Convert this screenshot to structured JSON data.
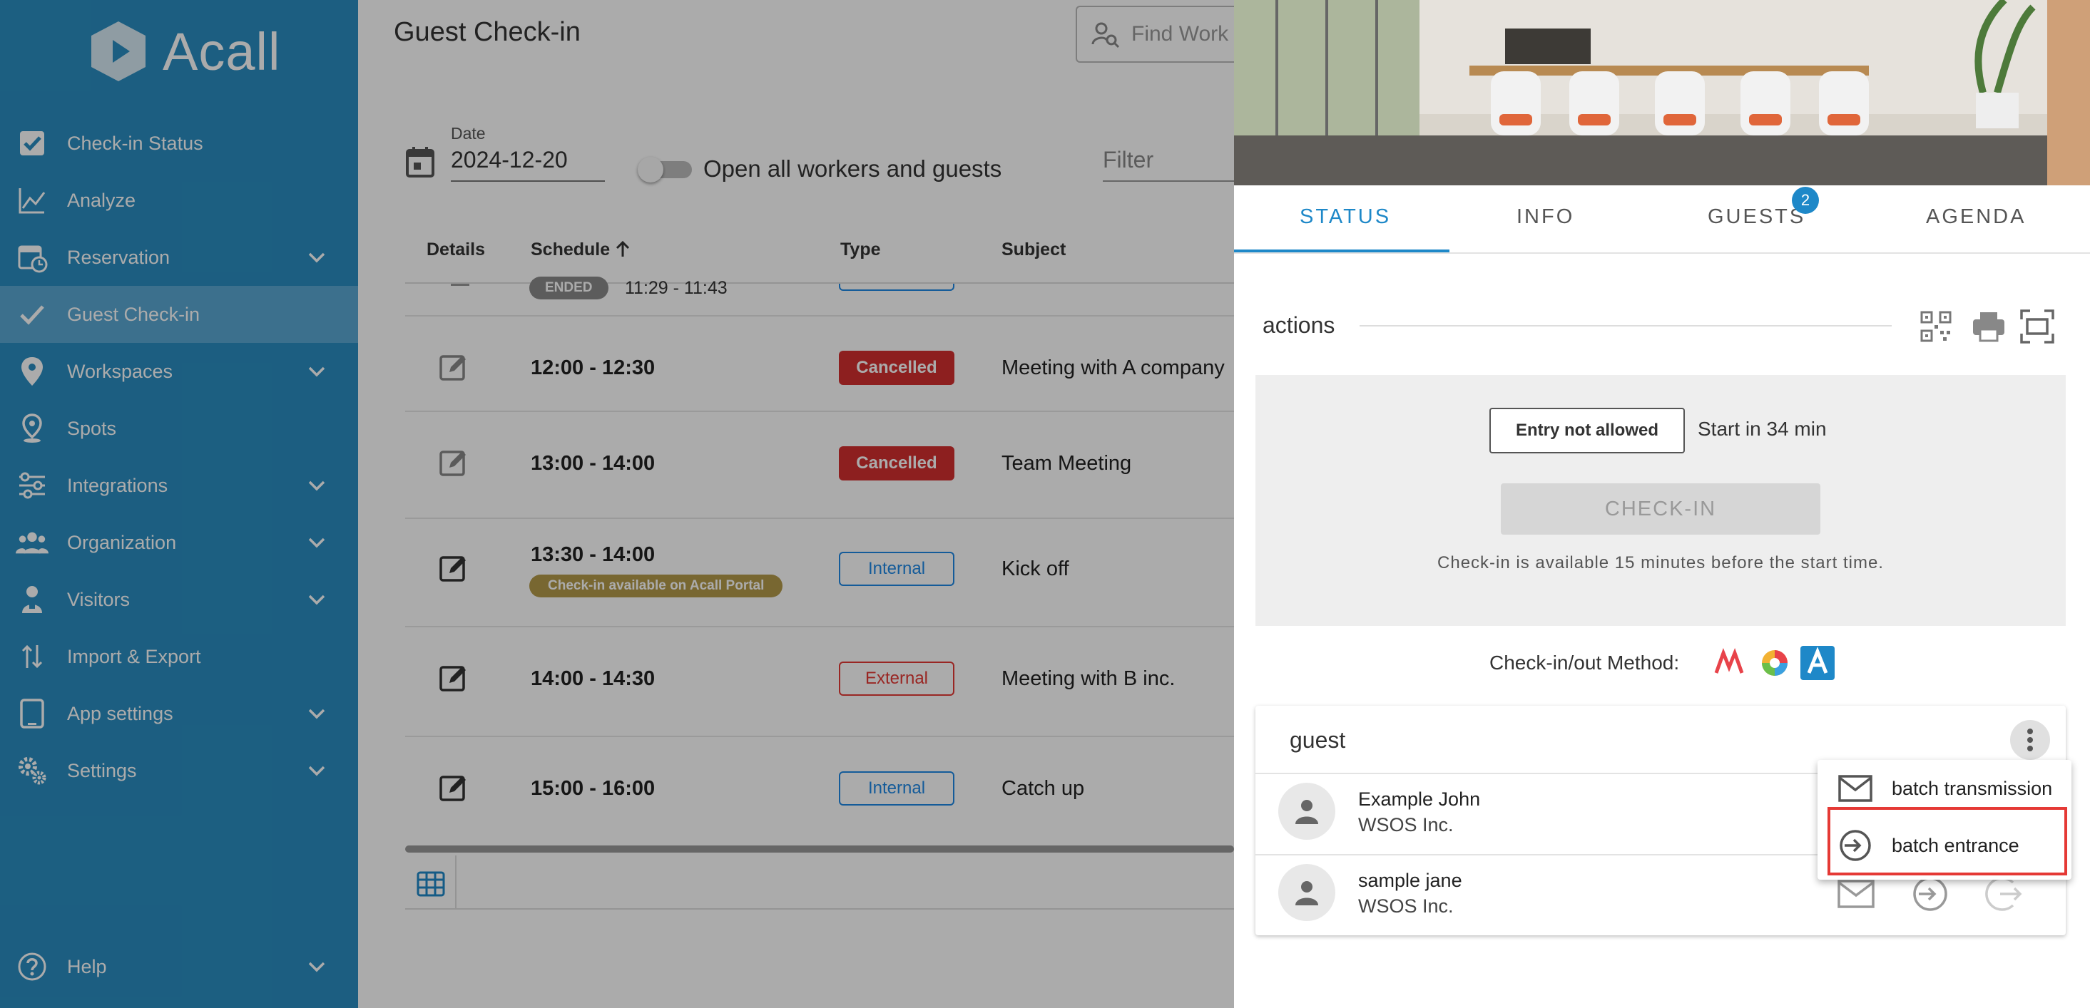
{
  "app": {
    "brand": "Acall"
  },
  "sidebar": {
    "items": [
      {
        "label": "Check-in Status",
        "icon": "checkbox-icon"
      },
      {
        "label": "Analyze",
        "icon": "chart-line-icon"
      },
      {
        "label": "Reservation",
        "icon": "calendar-clock-icon"
      },
      {
        "label": "Guest Check-in",
        "icon": "check-icon"
      },
      {
        "label": "Workspaces",
        "icon": "map-pin-icon"
      },
      {
        "label": "Spots",
        "icon": "location-icon"
      },
      {
        "label": "Integrations",
        "icon": "sliders-icon"
      },
      {
        "label": "Organization",
        "icon": "people-icon"
      },
      {
        "label": "Visitors",
        "icon": "visitor-icon"
      },
      {
        "label": "Import & Export",
        "icon": "import-export-icon"
      },
      {
        "label": "App settings",
        "icon": "tablet-icon"
      },
      {
        "label": "Settings",
        "icon": "gears-icon"
      },
      {
        "label": "Help",
        "icon": "help-icon"
      }
    ]
  },
  "main": {
    "title": "Guest Check-in",
    "search_placeholder": "Find Work",
    "date_label": "Date",
    "date_value": "2024-12-20",
    "toggle_label": "Open all workers and guests",
    "filter_placeholder": "Filter",
    "columns": [
      "Details",
      "Schedule",
      "Type",
      "Subject"
    ],
    "partial_row": {
      "badge": "ENDED",
      "time": "11:29 - 11:43"
    },
    "rows": [
      {
        "time": "12:00 - 12:30",
        "type": "Cancelled",
        "subject": "Meeting with A company"
      },
      {
        "time": "13:00 - 14:00",
        "type": "Cancelled",
        "subject": "Team Meeting"
      },
      {
        "time": "13:30 - 14:00",
        "type": "Internal",
        "subject": "Kick off",
        "note": "Check-in available on Acall Portal"
      },
      {
        "time": "14:00 - 14:30",
        "type": "External",
        "subject": "Meeting with B inc."
      },
      {
        "time": "15:00 - 16:00",
        "type": "Internal",
        "subject": "Catch up"
      }
    ]
  },
  "panel": {
    "tabs": [
      "STATUS",
      "INFO",
      "GUESTS",
      "AGENDA"
    ],
    "guests_count": "2",
    "actions_label": "actions",
    "entry_button": "Entry not allowed",
    "start_in": "Start in 34 min",
    "checkin_button": "CHECK-IN",
    "checkin_note": "Check-in is available 15 minutes before the start time.",
    "method_label": "Check-in/out Method:",
    "guest_section_title": "guest",
    "guests": [
      {
        "name": "Example John",
        "company": "WSOS Inc."
      },
      {
        "name": "sample jane",
        "company": "WSOS Inc."
      }
    ],
    "menu": [
      {
        "label": "batch transmission",
        "icon": "mail-icon"
      },
      {
        "label": "batch entrance",
        "icon": "login-icon"
      }
    ]
  },
  "colors": {
    "sidebar": "#2a8dc0",
    "accent": "#1e88c8",
    "cancelled": "#d32f2f",
    "highlight": "#e53935"
  }
}
